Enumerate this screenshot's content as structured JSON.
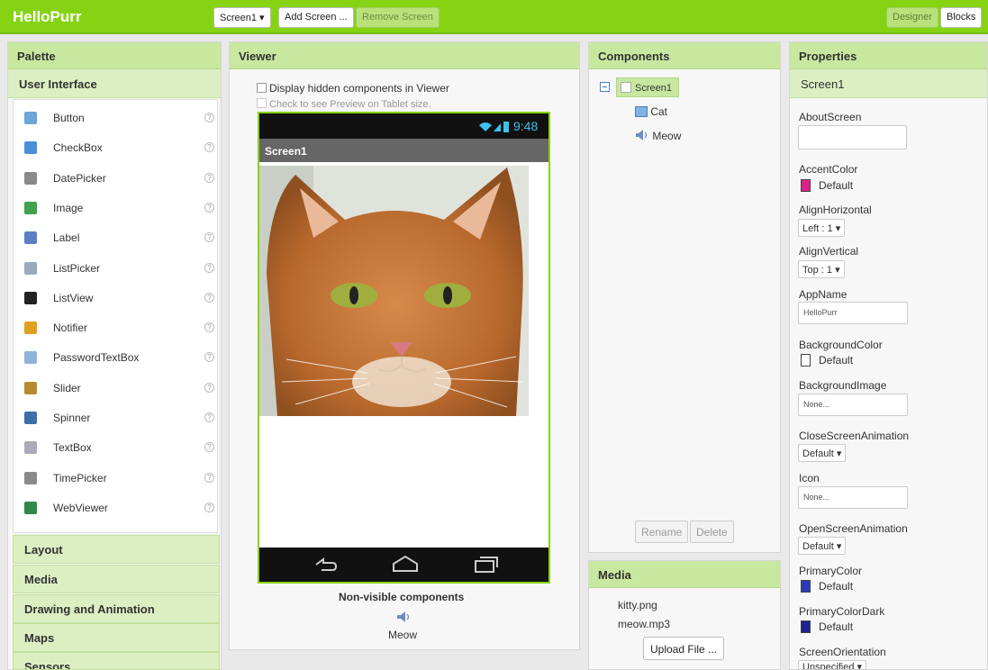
{
  "topbar": {
    "brand": "HelloPurr",
    "screen_select": "Screen1 ▾",
    "add_screen": "Add Screen ...",
    "remove_screen": "Remove Screen",
    "designer": "Designer",
    "blocks": "Blocks"
  },
  "palette": {
    "title": "Palette",
    "section": "User Interface",
    "items": [
      {
        "label": "Button",
        "icon": "button-icon",
        "color": "#6aa6d8"
      },
      {
        "label": "CheckBox",
        "icon": "checkbox-icon",
        "color": "#4a90d9"
      },
      {
        "label": "DatePicker",
        "icon": "datepicker-icon",
        "color": "#8a8a8a"
      },
      {
        "label": "Image",
        "icon": "image-icon",
        "color": "#3fa34d"
      },
      {
        "label": "Label",
        "icon": "label-icon",
        "color": "#5b7fc4"
      },
      {
        "label": "ListPicker",
        "icon": "listpicker-icon",
        "color": "#9ab"
      },
      {
        "label": "ListView",
        "icon": "listview-icon",
        "color": "#222"
      },
      {
        "label": "Notifier",
        "icon": "notifier-icon",
        "color": "#e0a020"
      },
      {
        "label": "PasswordTextBox",
        "icon": "password-icon",
        "color": "#8fb3d9"
      },
      {
        "label": "Slider",
        "icon": "slider-icon",
        "color": "#b88a2f"
      },
      {
        "label": "Spinner",
        "icon": "spinner-icon",
        "color": "#3d6fa8"
      },
      {
        "label": "TextBox",
        "icon": "textbox-icon",
        "color": "#aab"
      },
      {
        "label": "TimePicker",
        "icon": "timepicker-icon",
        "color": "#8a8a8a"
      },
      {
        "label": "WebViewer",
        "icon": "webviewer-icon",
        "color": "#2f8a4a"
      }
    ],
    "categories": [
      "Layout",
      "Media",
      "Drawing and Animation",
      "Maps",
      "Sensors"
    ]
  },
  "viewer": {
    "title": "Viewer",
    "hidden_components": "Display hidden components in Viewer",
    "tablet_preview": "Check to see Preview on Tablet size.",
    "time": "9:48",
    "screen_title": "Screen1",
    "nonvisible_title": "Non-visible components",
    "nonvisible_item": "Meow"
  },
  "components": {
    "title": "Components",
    "root": "Screen1",
    "children": [
      "Cat",
      "Meow"
    ],
    "rename": "Rename",
    "delete": "Delete"
  },
  "media": {
    "title": "Media",
    "files": [
      "kitty.png",
      "meow.mp3"
    ],
    "upload": "Upload File ..."
  },
  "properties": {
    "title": "Properties",
    "component": "Screen1",
    "about_label": "AboutScreen",
    "accent_label": "AccentColor",
    "accent_value": "Default",
    "accent_color": "#e0208a",
    "align_h_label": "AlignHorizontal",
    "align_h_value": "Left : 1 ▾",
    "align_v_label": "AlignVertical",
    "align_v_value": "Top : 1 ▾",
    "appname_label": "AppName",
    "appname_value": "HelloPurr",
    "bgcolor_label": "BackgroundColor",
    "bgcolor_value": "Default",
    "bgimage_label": "BackgroundImage",
    "bgimage_value": "None...",
    "close_anim_label": "CloseScreenAnimation",
    "close_anim_value": "Default ▾",
    "icon_label": "Icon",
    "icon_value": "None...",
    "open_anim_label": "OpenScreenAnimation",
    "open_anim_value": "Default ▾",
    "primary_label": "PrimaryColor",
    "primary_value": "Default",
    "primary_color": "#2a3bb8",
    "primary_dark_label": "PrimaryColorDark",
    "primary_dark_value": "Default",
    "primary_dark_color": "#1a2590",
    "orientation_label": "ScreenOrientation",
    "orientation_value": "Unspecified ▾"
  }
}
